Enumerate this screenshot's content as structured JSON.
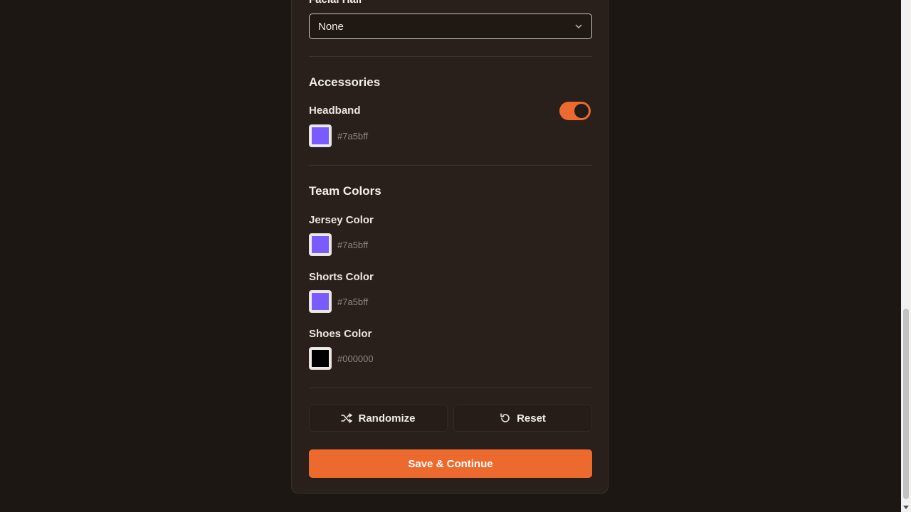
{
  "facial_hair": {
    "label": "Facial Hair",
    "value": "None",
    "chevron_icon": "chevron-down-icon"
  },
  "accessories": {
    "title": "Accessories",
    "headband": {
      "label": "Headband",
      "enabled": true,
      "color": "#7a5bff",
      "color_text": "#7a5bff"
    }
  },
  "team_colors": {
    "title": "Team Colors",
    "jersey": {
      "label": "Jersey Color",
      "color": "#7a5bff",
      "color_text": "#7a5bff"
    },
    "shorts": {
      "label": "Shorts Color",
      "color": "#7a5bff",
      "color_text": "#7a5bff"
    },
    "shoes": {
      "label": "Shoes Color",
      "color": "#000000",
      "color_text": "#000000"
    }
  },
  "actions": {
    "randomize_label": "Randomize",
    "randomize_icon": "shuffle-icon",
    "reset_label": "Reset",
    "reset_icon": "reset-icon",
    "save_label": "Save & Continue"
  },
  "colors": {
    "accent": "#ec6a2e",
    "background": "#1c1713",
    "panel": "#2a201b"
  }
}
